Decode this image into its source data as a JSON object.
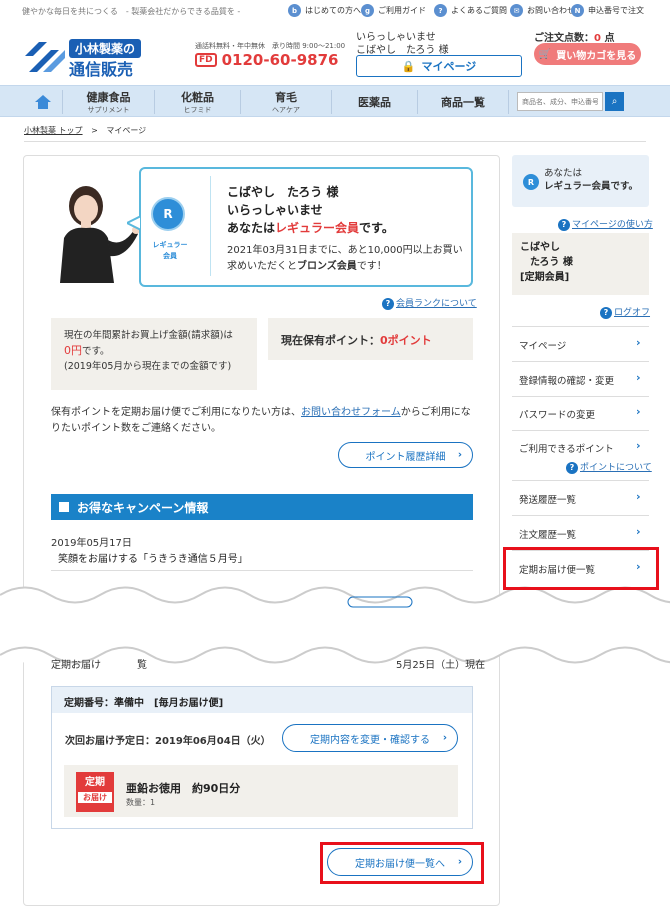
{
  "topbar": {
    "tagline": "健やかな毎日を共につくる　- 製薬会社だからできる品質を -",
    "links": [
      {
        "icon": "beginner-icon",
        "label": "はじめての方へ"
      },
      {
        "icon": "guide-icon",
        "label": "ご利用ガイド"
      },
      {
        "icon": "faq-icon",
        "label": "よくあるご質問"
      },
      {
        "icon": "mail-icon",
        "label": "お問い合わせ"
      },
      {
        "icon": "order-number-icon",
        "label": "申込番号で注文"
      }
    ]
  },
  "header": {
    "logo_top": "小林製薬の",
    "logo_bottom": "通信販売",
    "phone_note": "通話料無料・年中無休　承り時間 9:00～21:00",
    "phone_mark": "FD",
    "phone": "0120-60-9876",
    "greeting": "いらっしゃいませ",
    "user_name": "こばやし　たろう 様",
    "mypage_button": "マイページ",
    "cart_count_label": "ご注文点数：",
    "cart_count": "0",
    "cart_count_unit": "点",
    "cart_button": "買い物カゴを見る"
  },
  "nav": {
    "items": [
      {
        "label": "健康食品",
        "sub": "サプリメント"
      },
      {
        "label": "化粧品",
        "sub": "ヒフミド"
      },
      {
        "label": "育毛",
        "sub": "ヘアケア"
      },
      {
        "label": "医薬品",
        "sub": ""
      },
      {
        "label": "商品一覧",
        "sub": ""
      }
    ],
    "search_placeholder": "商品名、成分、申込番号"
  },
  "breadcrumb": {
    "home": "小林製薬 トップ",
    "sep": ">",
    "current": "マイページ"
  },
  "rank": {
    "badge": "R",
    "badge_label": "レギュラー\n会員",
    "line1": "こばやし　たろう 様",
    "line2": "いらっしゃいませ",
    "line3_prefix": "あなたは",
    "line3_rank": "レギュラー会員",
    "line3_suffix": "です。",
    "note_prefix": "2021年03月31日までに、あと10,000円以上お買い求めいただくと",
    "note_rank": "ブロンズ会員",
    "note_suffix": "です！",
    "help_link": "会員ランクについて"
  },
  "stats": {
    "purchase_label": "現在の年間累計お買上げ金額(請求額)は",
    "purchase_amount": "0円",
    "purchase_suffix": "です。",
    "purchase_period": "(2019年05月から現在までの金額です)",
    "points_label": "現在保有ポイント：",
    "points_value": "0ポイント"
  },
  "point_note": {
    "prefix": "保有ポイントを定期お届け便でご利用になりたい方は、",
    "link": "お問い合わせフォーム",
    "suffix": "からご利用になりたいポイント数をご連絡ください。",
    "button": "ポイント履歴詳細"
  },
  "campaign": {
    "title": "お得なキャンペーン情報",
    "date": "2019年05月17日",
    "item": "笑顔をお届けする「うきうき通信５月号」"
  },
  "teiki": {
    "head_left": "定期お届け",
    "head_left_tail": "覧",
    "head_right": "5月25日（土）現在",
    "number_label": "定期番号：準備中　[毎月お届け便]",
    "next_date": "次回お届け予定日：2019年06月04日（火）",
    "change_button": "定期内容を変更・確認する",
    "tag_top": "定期",
    "tag_bottom": "お届け",
    "product_name": "亜鉛お徳用　約90日分",
    "product_qty": "数量：1",
    "list_button": "定期お届け便一覧へ"
  },
  "sidebar": {
    "badge": "R",
    "member_line1": "あなたは",
    "member_line2": "レギュラー会員です。",
    "help_link": "マイページの使い方",
    "user_line1": "こばやし",
    "user_line2": "　たろう 様",
    "user_line3": "[定期会員]",
    "logout": "ログオフ",
    "menu": [
      "マイページ",
      "登録情報の確認・変更",
      "パスワードの変更",
      "ご利用できるポイント",
      "発送履歴一覧",
      "注文履歴一覧",
      "定期お届け便一覧"
    ],
    "points_help": "ポイントについて"
  },
  "colors": {
    "brand_blue": "#1a73c2",
    "accent_red": "#e23b3b",
    "highlight_frame": "#e8101b",
    "nav_bg": "#d6e6f5"
  }
}
